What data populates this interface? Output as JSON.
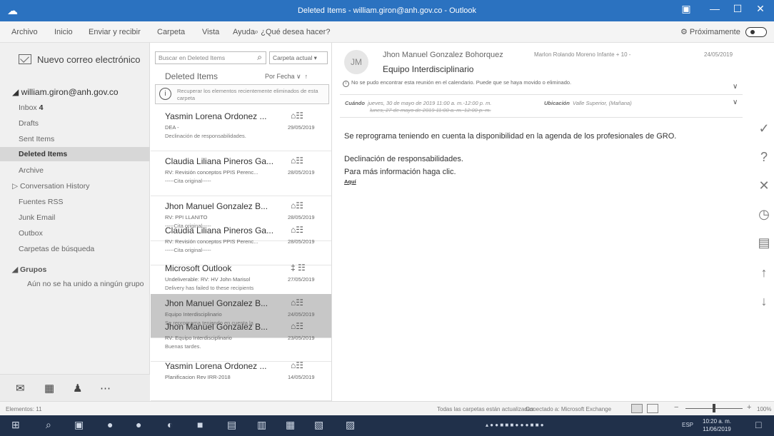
{
  "window": {
    "title": "Deleted Items - william.giron@anh.gov.co - Outlook",
    "app_icon": "outlook-icon",
    "controls": [
      "restore-icon",
      "minimize-icon",
      "maximize-icon",
      "close-icon"
    ]
  },
  "menu": {
    "items": [
      "Archivo",
      "Inicio",
      "Enviar y recibir",
      "Carpeta",
      "Vista",
      "Ayuda"
    ],
    "tell_me": "¿Qué desea hacer?",
    "coming_soon": "Próximamente"
  },
  "sidebar": {
    "new_mail": "Nuevo correo electrónico",
    "account": "william.giron@anh.gov.co",
    "folders": [
      {
        "label": "Inbox",
        "count": "4"
      },
      {
        "label": "Drafts"
      },
      {
        "label": "Sent Items"
      },
      {
        "label": "Deleted Items"
      },
      {
        "label": "Archive"
      },
      {
        "label": "Conversation History"
      },
      {
        "label": "Fuentes RSS"
      },
      {
        "label": "Junk Email"
      },
      {
        "label": "Outbox"
      },
      {
        "label": "Carpetas de búsqueda"
      }
    ],
    "groups_title": "Grupos",
    "no_group": "Aún no se ha unido a ningún grupo",
    "nav": [
      "mail-icon",
      "calendar-icon",
      "people-icon",
      "more-icon"
    ]
  },
  "list": {
    "search_placeholder": "Buscar en Deleted Items",
    "scope": "Carpeta actual",
    "header": "Deleted Items",
    "sort": "Por Fecha",
    "recover_text": "Recuperar los elementos recientemente eliminados de esta carpeta",
    "messages": [
      {
        "from": "Yasmin Lorena Ordonez ...",
        "subject": "DEA -",
        "date": "29/05/2019",
        "preview": "Declinación de responsabilidades."
      },
      {
        "from": "Claudia Liliana Pineros Ga...",
        "subject": "RV: Revisión conceptos PPIS Perenc...",
        "date": "28/05/2019",
        "preview": "-----Cita original-----"
      },
      {
        "from": "Jhon Manuel Gonzalez B...",
        "subject": "RV: PPI LLANITO",
        "date": "28/05/2019",
        "preview": "-----Cita original-----"
      },
      {
        "from": "Claudia Liliana Pineros Ga...",
        "subject": "RV: Revisión conceptos PPIS Perenc...",
        "date": "28/05/2019",
        "preview": "-----Cita original-----"
      },
      {
        "from": "Microsoft Outlook",
        "subject": "Undeliverable: RV: HV John Marisol",
        "date": "27/05/2019",
        "preview": "Delivery has failed to these recipients"
      },
      {
        "from": "Jhon Manuel Gonzalez B...",
        "subject": "Equipo Interdisciplinario",
        "date": "24/05/2019",
        "preview": "Se reprograma teniendo en cuenta la"
      },
      {
        "from": "Jhon Manuel Gonzalez B...",
        "subject": "RV: Equipo Interdisciplinario",
        "date": "23/05/2019",
        "preview": "Buenas tardes."
      },
      {
        "from": "Yasmin Lorena Ordonez ...",
        "subject": "Planificacion Rev IRR-2018",
        "date": "14/05/2019",
        "preview": ""
      }
    ]
  },
  "reading": {
    "avatar": "JM",
    "from": "Jhon Manuel Gonzalez Bohorquez",
    "to": "Marlon Rolando Moreno Infante  + 10 -",
    "date": "24/05/2019",
    "subject": "Equipo Interdisciplinario",
    "info": "No se pudo encontrar esta reunión en el calendario. Puede que se haya movido o eliminado.",
    "when_label": "Cuándo",
    "when": "jueves, 30 de mayo de 2019 11:00 a. m.-12:00 p. m.",
    "when_old": "lunes, 27 de mayo de 2019 11:00 a. m.-12:00 p. m.",
    "location_label": "Ubicación",
    "location": "Valle Superior, (Mañana)",
    "body_line1": "Se reprograma teniendo en cuenta la disponibilidad en la agenda de los profesionales de GRO.",
    "body_line2": "Declinación de responsabilidades.",
    "body_line3": "Para más información haga clic.",
    "link": "Aquí"
  },
  "rail": [
    "accept-check-icon",
    "tentative-question-icon",
    "decline-x-icon",
    "propose-time-clock-icon",
    "calendar-icon",
    "up-arrow-icon",
    "down-arrow-icon"
  ],
  "status": {
    "items": "Elementos: 11",
    "updated": "Todas las carpetas están actualizadas.",
    "connected": "Conectado a: Microsoft Exchange",
    "zoom": "100%",
    "zoom_fraction": 0.5
  },
  "taskbar": {
    "lang": "ESP",
    "time": "10:20 a. m.",
    "date": "11/06/2019"
  }
}
